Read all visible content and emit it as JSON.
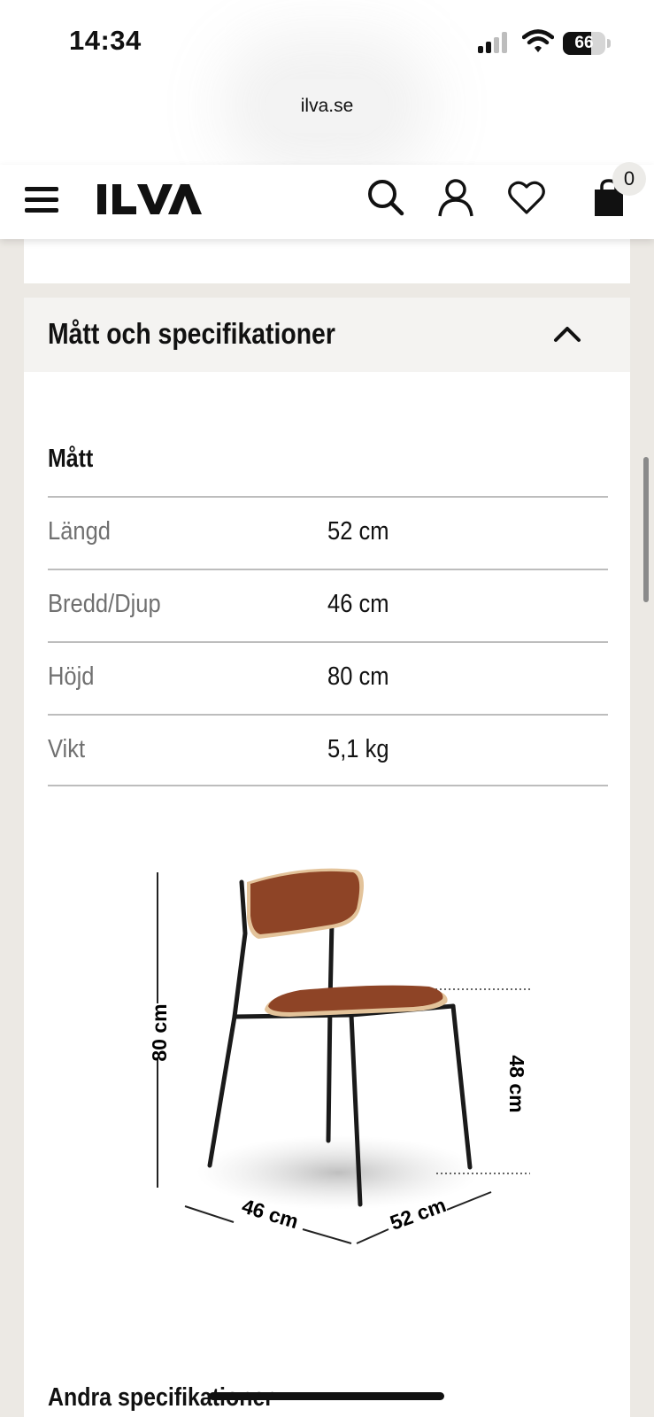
{
  "status_bar": {
    "time": "14:34",
    "battery": "66"
  },
  "browser": {
    "url": "ilva.se"
  },
  "header": {
    "logo": "ILVA",
    "cart_count": "0",
    "icons": [
      "menu-icon",
      "search-icon",
      "account-icon",
      "heart-icon",
      "cart-icon"
    ]
  },
  "section": {
    "title": "Mått och specifikationer",
    "dimensions_title": "Mått",
    "rows": [
      {
        "label": "Längd",
        "value": "52 cm"
      },
      {
        "label": "Bredd/Djup",
        "value": "46 cm"
      },
      {
        "label": "Höjd",
        "value": "80 cm"
      },
      {
        "label": "Vikt",
        "value": "5,1 kg"
      }
    ],
    "diagram_labels": {
      "height": "80 cm",
      "seat_height": "48 cm",
      "width": "46 cm",
      "depth": "52 cm"
    },
    "other_title": "Andra specifikationer"
  },
  "colors": {
    "accent": "#111111",
    "leather": "#8e4426",
    "wood": "#e3c39a"
  }
}
